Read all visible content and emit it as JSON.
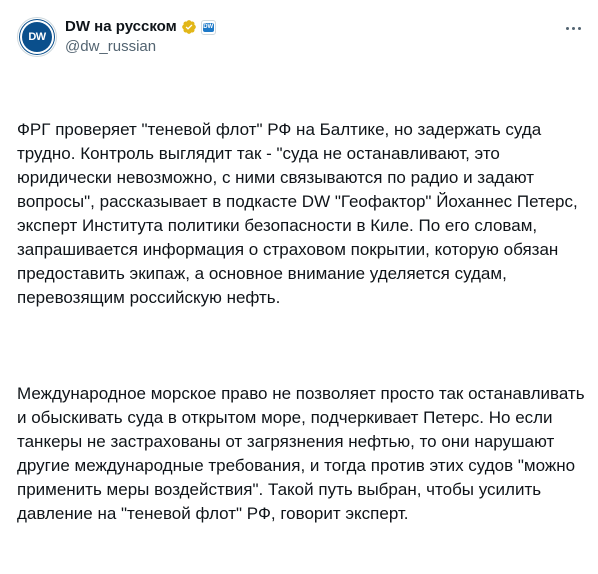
{
  "account": {
    "display_name": "DW на русском",
    "handle": "@dw_russian",
    "avatar_text": "DW",
    "verified": true,
    "verified_color": "#e2b719",
    "affiliation_badge_text": "DW"
  },
  "post": {
    "paragraphs": [
      "ФРГ проверяет \"теневой флот\" РФ на Балтике, но задержать суда трудно. Контроль выглядит так - \"суда не останавливают, это юридически невозможно, с ними связываются по радио и задают вопросы\", рассказывает в подкасте DW \"Геофактор\" Йоханнес Петерс, эксперт Института политики безопасности в Киле. По его словам, запрашивается информация о страховом покрытии, которую обязан предоставить экипаж, а основное внимание уделяется судам, перевозящим российскую нефть.",
      "Международное морское право не позволяет просто так останавливать и обыскивать суда в открытом море, подчеркивает Петерс. Но если танкеры не застрахованы от загрязнения нефтью, то они нарушают другие международные требования, и тогда против этих судов \"можно применить меры воздействия\". Такой путь выбран, чтобы усилить давление на \"теневой флот\" РФ, говорит эксперт."
    ]
  },
  "colors": {
    "text_primary": "#0f1419",
    "text_secondary": "#536471",
    "brand": "#0a4f8c"
  }
}
